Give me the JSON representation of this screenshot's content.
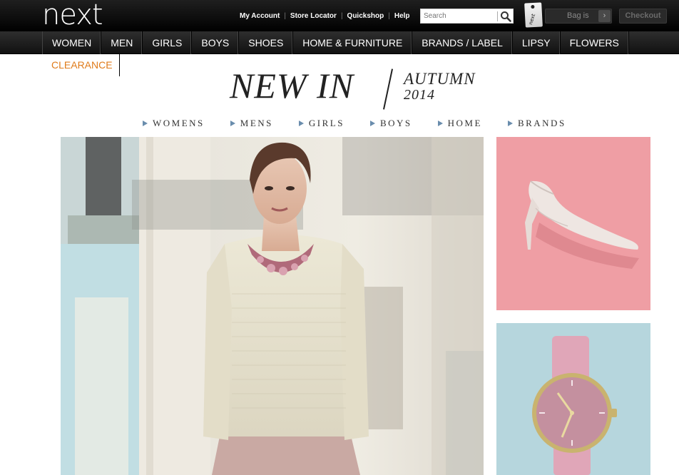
{
  "header": {
    "logo": "next",
    "links": [
      "My Account",
      "Store Locator",
      "Quickshop",
      "Help"
    ],
    "search_placeholder": "Search",
    "bag_tag_text": "next",
    "bag_label": "Bag is",
    "bag_arrow": "›",
    "checkout_label": "Checkout"
  },
  "nav": {
    "items": [
      "WOMEN",
      "MEN",
      "GIRLS",
      "BOYS",
      "SHOES",
      "HOME & FURNITURE",
      "BRANDS / LABEL",
      "LIPSY",
      "FLOWERS"
    ],
    "clearance": "CLEARANCE"
  },
  "hero": {
    "title": "NEW IN",
    "season": "AUTUMN",
    "year": "2014",
    "subnav": [
      "WOMENS",
      "MENS",
      "GIRLS",
      "BOYS",
      "HOME",
      "BRANDS"
    ]
  },
  "colors": {
    "accent_clearance": "#e07b1a",
    "subnav_arrow": "#6a8dad",
    "shoe_panel": "#ef9ea4",
    "watch_panel": "#b6d6dd"
  },
  "images": {
    "main": "model-autumn-fashion-photo",
    "side_top": "nude-stiletto-shoe-photo",
    "side_bottom": "pink-watch-photo"
  }
}
